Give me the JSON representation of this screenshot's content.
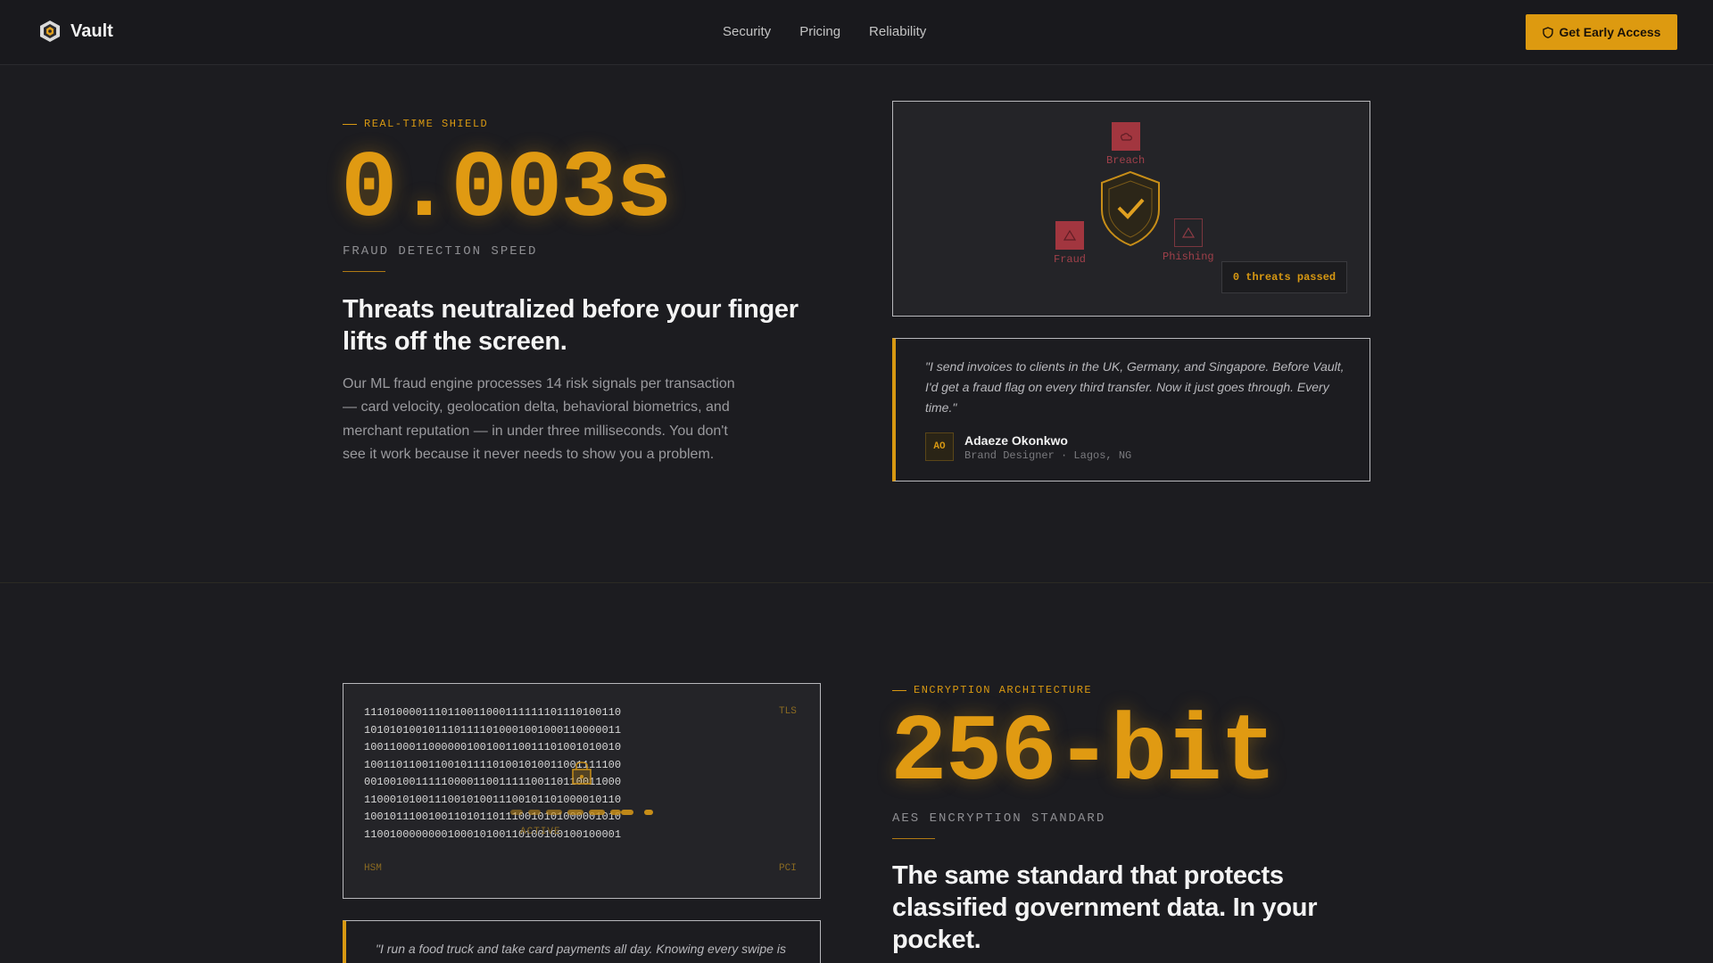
{
  "nav": {
    "brand": "Vault",
    "links": [
      "Security",
      "Pricing",
      "Reliability"
    ],
    "cta": "Get Early Access"
  },
  "fraud": {
    "eyebrow": "REAL-TIME SHIELD",
    "metric": "0.003s",
    "metric_label": "FRAUD DETECTION SPEED",
    "headline": "Threats neutralized before your finger lifts off the screen.",
    "body": "Our ML fraud engine processes 14 risk signals per transaction — card velocity, geolocation delta, behavioral biometrics, and merchant reputation — in under three milliseconds. You don't see it work because it never needs to show you a problem.",
    "threats": [
      "Breach",
      "Fraud",
      "Phishing"
    ],
    "badge": "0 threats passed",
    "quote": "\"I send invoices to clients in the UK, Germany, and Singapore. Before Vault, I'd get a fraud flag on every third transfer. Now it just goes through. Every time.\"",
    "person": {
      "initials": "AO",
      "name": "Adaeze Okonkwo",
      "role": "Brand Designer · Lagos, NG"
    }
  },
  "encryption": {
    "eyebrow": "ENCRYPTION ARCHITECTURE",
    "metric": "256-bit",
    "metric_label": "AES ENCRYPTION STANDARD",
    "headline": "The same standard that protects classified government data. In your pocket.",
    "corners": {
      "tl": "TLS",
      "bl": "HSM",
      "br": "PCI"
    },
    "binary": "1110100001110110011000111111101110100110\n1010101001011101111010001001000110000011\n1001100011000000100100110011101001010010\n1001101100110010111101001010011001111100\n0010010011111000011001111100110110011000\n1100010100111001010011100101101000010110\n1001011100100110101101110010101000001010\n1100100000000100010100110100100100100001",
    "active_label": "ACTIVE",
    "quote": "\"I run a food truck and take card payments all day. Knowing every swipe is"
  }
}
